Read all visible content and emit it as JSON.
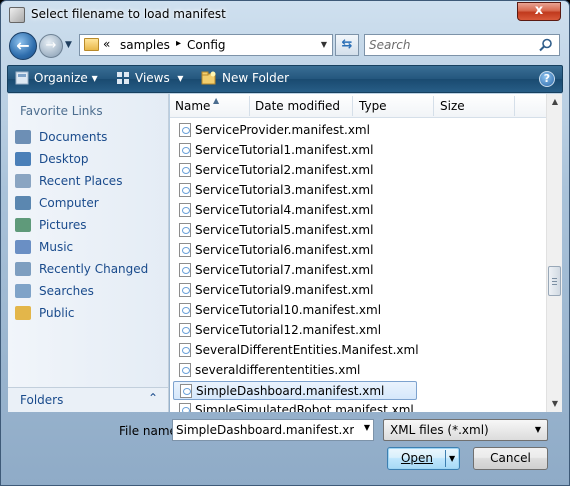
{
  "window": {
    "title": "Select filename to load manifest",
    "close_glyph": "x"
  },
  "address": {
    "chevron": "«",
    "segments": [
      "samples",
      "Config"
    ],
    "separator": "▸"
  },
  "search": {
    "placeholder": "Search"
  },
  "commandbar": {
    "organize": "Organize",
    "views": "Views",
    "new_folder": "New Folder",
    "help": "?"
  },
  "sidebar": {
    "title": "Favorite Links",
    "items": [
      {
        "label": "Documents",
        "icon": "documents-icon",
        "color": "#6d8fb5"
      },
      {
        "label": "Desktop",
        "icon": "desktop-icon",
        "color": "#4a7fb8"
      },
      {
        "label": "Recent Places",
        "icon": "recent-places-icon",
        "color": "#8aa5c2"
      },
      {
        "label": "Computer",
        "icon": "computer-icon",
        "color": "#5b87b0"
      },
      {
        "label": "Pictures",
        "icon": "pictures-icon",
        "color": "#5f9a7a"
      },
      {
        "label": "Music",
        "icon": "music-icon",
        "color": "#6a8fc4"
      },
      {
        "label": "Recently Changed",
        "icon": "recently-changed-icon",
        "color": "#7d9ec0"
      },
      {
        "label": "Searches",
        "icon": "searches-icon",
        "color": "#7fa3c8"
      },
      {
        "label": "Public",
        "icon": "public-folder-icon",
        "color": "#e3b64a"
      }
    ],
    "folders_label": "Folders",
    "folders_chevron": "⌃"
  },
  "columns": [
    "Name",
    "Date modified",
    "Type",
    "Size"
  ],
  "files": [
    "ServiceProvider.manifest.xml",
    "ServiceTutorial1.manifest.xml",
    "ServiceTutorial2.manifest.xml",
    "ServiceTutorial3.manifest.xml",
    "ServiceTutorial4.manifest.xml",
    "ServiceTutorial5.manifest.xml",
    "ServiceTutorial6.manifest.xml",
    "ServiceTutorial7.manifest.xml",
    "ServiceTutorial9.manifest.xml",
    "ServiceTutorial10.manifest.xml",
    "ServiceTutorial12.manifest.xml",
    "SeveralDifferentEntities.Manifest.xml",
    "severaldifferententities.xml",
    "SimpleDashboard.manifest.xml",
    "SimpleSimulatedRobot.manifest.xml"
  ],
  "selected_index": 13,
  "bottom": {
    "file_name_label": "File name:",
    "file_name_value": "SimpleDashboard.manifest.xml",
    "file_type_value": "XML files (*.xml)",
    "open_label": "Open",
    "cancel_label": "Cancel"
  }
}
